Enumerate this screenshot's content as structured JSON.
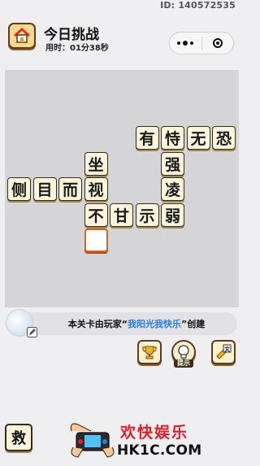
{
  "header": {
    "id_label": "ID: 140572535",
    "title": "今日挑战",
    "timer_prefix": "用时：",
    "timer_value": "01分38秒"
  },
  "board": {
    "tiles": [
      {
        "ch": "有",
        "col": 5,
        "row": 0
      },
      {
        "ch": "恃",
        "col": 6,
        "row": 0
      },
      {
        "ch": "无",
        "col": 7,
        "row": 0
      },
      {
        "ch": "恐",
        "col": 8,
        "row": 0
      },
      {
        "ch": "坐",
        "col": 3,
        "row": 1
      },
      {
        "ch": "强",
        "col": 6,
        "row": 1
      },
      {
        "ch": "侧",
        "col": 0,
        "row": 2
      },
      {
        "ch": "目",
        "col": 1,
        "row": 2
      },
      {
        "ch": "而",
        "col": 2,
        "row": 2
      },
      {
        "ch": "视",
        "col": 3,
        "row": 2
      },
      {
        "ch": "凌",
        "col": 6,
        "row": 2
      },
      {
        "ch": "不",
        "col": 3,
        "row": 3
      },
      {
        "ch": "甘",
        "col": 4,
        "row": 3
      },
      {
        "ch": "示",
        "col": 5,
        "row": 3
      },
      {
        "ch": "弱",
        "col": 6,
        "row": 3
      }
    ],
    "blank_cell": {
      "col": 3,
      "row": 4,
      "ch": ""
    }
  },
  "creator": {
    "prefix": "本关卡由玩家“",
    "name": "我阳光我快乐",
    "suffix": "”创建"
  },
  "tools": {
    "hint_caption": "提示",
    "rescue_label": "救"
  },
  "watermark": {
    "cn": "欢快娱乐",
    "en": "HK1C.COM"
  },
  "colors": {
    "tile_bg": "#fbf5dd",
    "tile_border": "#3b2a14",
    "blank_border": "#d1662a",
    "creator_name": "#2b7be0",
    "logo_red": "#e21e2a"
  }
}
